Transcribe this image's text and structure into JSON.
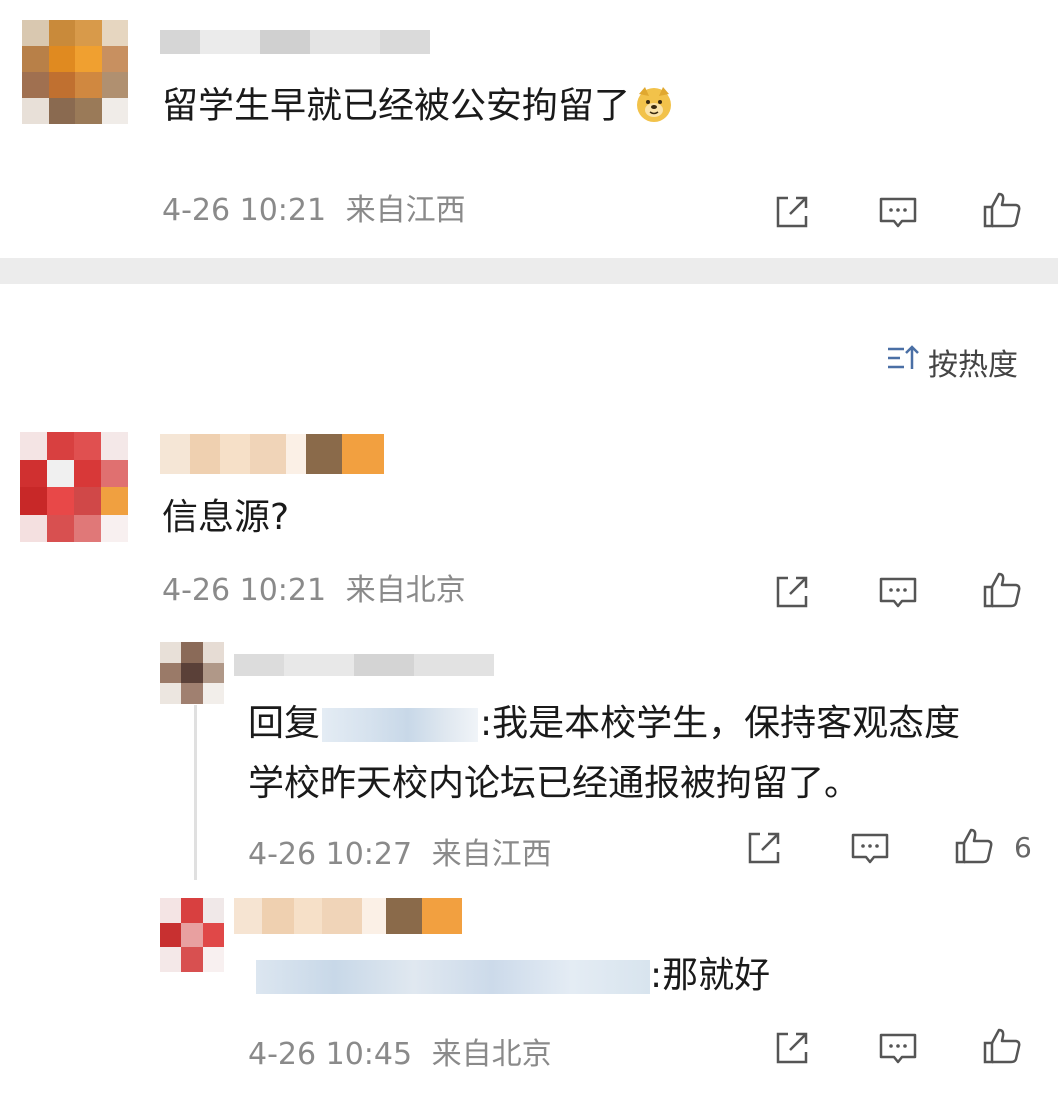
{
  "comments": [
    {
      "id": "top",
      "text": "留学生早就已经被公安拘留了",
      "emoji": "doge-emoji",
      "time": "4-26 10:21",
      "location": "来自江西"
    },
    {
      "id": "c1",
      "text": "信息源?",
      "time": "4-26 10:21",
      "location": "来自北京",
      "replies": [
        {
          "id": "r1",
          "reply_prefix": "回复",
          "line1_after": ":我是本校学生，保持客观态度",
          "line2": "学校昨天校内论坛已经通报被拘留了。",
          "time": "4-26 10:27",
          "location": "来自江西",
          "like_count": "6"
        },
        {
          "id": "r2",
          "text_after": ":那就好",
          "time": "4-26 10:45",
          "location": "来自北京"
        }
      ]
    }
  ],
  "sort": {
    "label": "按热度",
    "icon": "sort-icon"
  },
  "icons": {
    "share": "share-icon",
    "comment": "comment-icon",
    "like": "like-icon"
  },
  "colors": {
    "text": "#1a1a1a",
    "meta": "#8a8a8a",
    "divider": "#ececec"
  }
}
